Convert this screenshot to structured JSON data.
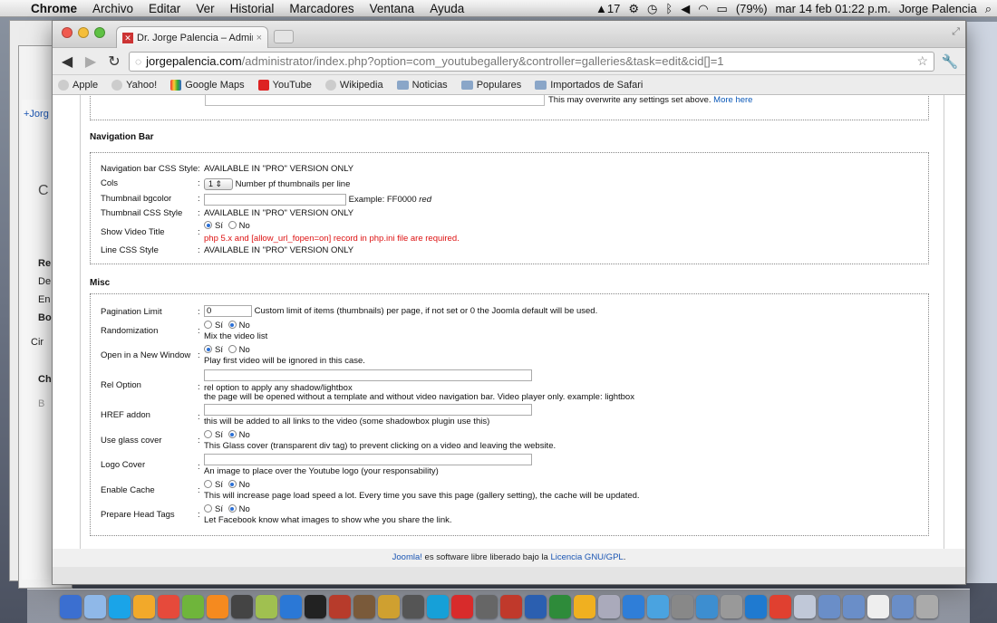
{
  "menubar": {
    "items": [
      "Chrome",
      "Archivo",
      "Editar",
      "Ver",
      "Historial",
      "Marcadores",
      "Ventana",
      "Ayuda"
    ],
    "status": {
      "adobe": "17",
      "battery": "(79%)",
      "datetime": "mar 14 feb  01:22 p.m.",
      "user": "Jorge Palencia"
    }
  },
  "left_panel": {
    "items": [
      "+Jorg",
      "C",
      "Re",
      "De",
      "En",
      "Bo",
      "Cir",
      "Ch",
      "B"
    ]
  },
  "browser": {
    "tab_title": "Dr. Jorge Palencia – Administ",
    "url_domain": "jorgepalencia.com",
    "url_path": "/administrator/index.php?option=com_youtubegallery&controller=galleries&task=edit&cid[]=1",
    "bookmarks": [
      {
        "label": "Apple",
        "icon": "globe-icon"
      },
      {
        "label": "Yahoo!",
        "icon": "globe-icon"
      },
      {
        "label": "Google Maps",
        "icon": "google-maps-icon"
      },
      {
        "label": "YouTube",
        "icon": "youtube-icon"
      },
      {
        "label": "Wikipedia",
        "icon": "globe-icon"
      },
      {
        "label": "Noticias",
        "icon": "folder-icon"
      },
      {
        "label": "Populares",
        "icon": "folder-icon"
      },
      {
        "label": "Importados de Safari",
        "icon": "folder-icon"
      }
    ]
  },
  "page": {
    "top_note": "This may overwrite any settings set above.",
    "top_note_link": "More here",
    "nav_section": {
      "title": "Navigation Bar",
      "navbar_css_label": "Navigation bar CSS Style",
      "pro_only": "AVAILABLE IN \"PRO\" VERSION ONLY",
      "cols_label": "Cols",
      "cols_value": "1",
      "cols_help": "Number pf thumbnails per line",
      "bgcolor_label": "Thumbnail bgcolor",
      "bgcolor_example": "Example: FF0000",
      "bgcolor_example_word": "red",
      "thumb_css_label": "Thumbnail CSS Style",
      "show_title_label": "Show Video Title",
      "yes": "Sí",
      "no": "No",
      "show_title_warning": "php 5.x and [allow_url_fopen=on] record in php.ini file are required.",
      "line_css_label": "Line CSS Style"
    },
    "misc_section": {
      "title": "Misc",
      "pagination_label": "Pagination Limit",
      "pagination_value": "0",
      "pagination_help": "Custom limit of items (thumbnails) per page, if not set or 0 the Joomla default will be used.",
      "random_label": "Randomization",
      "random_help": "Mix the video list",
      "newwin_label": "Open in a New Window",
      "newwin_help": "Play first video will be ignored in this case.",
      "rel_label": "Rel Option",
      "rel_help1": "rel option to apply any shadow/lightbox",
      "rel_help2": "the page will be opened without a template and without video navigation bar. Video player only. example: lightbox",
      "href_label": "HREF addon",
      "href_help": "this will be added to all links to the video (some shadowbox plugin use this)",
      "glass_label": "Use glass cover",
      "glass_help": "This Glass cover (transparent div tag) to prevent clicking on a video and leaving the website.",
      "logo_label": "Logo Cover",
      "logo_help": "An image to place over the Youtube logo (your responsability)",
      "cache_label": "Enable Cache",
      "cache_help": "This will increase page load speed a lot. Every time you save this page (gallery setting), the cache will be updated.",
      "headtags_label": "Prepare Head Tags",
      "headtags_help": "Let Facebook know what images to show whe you share the link."
    },
    "footer": {
      "link1": "Joomla!",
      "text": " es software libre liberado bajo la ",
      "link2": "Licencia GNU/GPL",
      "end": "."
    }
  },
  "colors": {
    "link": "#0a58b8",
    "warning": "#dd1111",
    "radio_selected": "#2a6fd6"
  }
}
